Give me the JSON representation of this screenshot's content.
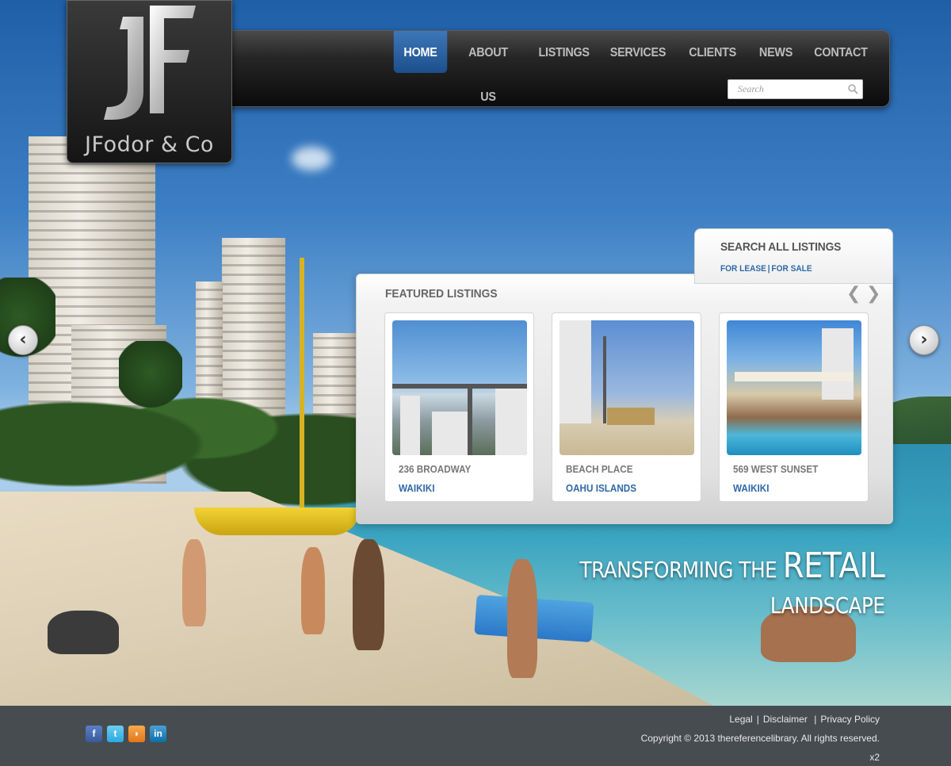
{
  "brand": {
    "name": "JFodor & Co",
    "logo_mark": "JF"
  },
  "nav": {
    "items": [
      {
        "label": "HOME",
        "active": true
      },
      {
        "label": "ABOUT US",
        "active": false
      },
      {
        "label": "LISTINGS",
        "active": false
      },
      {
        "label": "SERVICES",
        "active": false
      },
      {
        "label": "CLIENTS",
        "active": false
      },
      {
        "label": "NEWS",
        "active": false
      },
      {
        "label": "CONTACT",
        "active": false
      }
    ],
    "search_placeholder": "Search"
  },
  "search_all": {
    "title": "SEARCH ALL LISTINGS",
    "for_lease": "FOR LEASE",
    "separator": "|",
    "for_sale": "FOR SALE"
  },
  "featured": {
    "title": "FEATURED LISTINGS",
    "prev_icon": "❮",
    "next_icon": "❯",
    "listings": [
      {
        "address": "236 BROADWAY",
        "area": "WAIKIKI",
        "image": "city-view-from-balcony"
      },
      {
        "address": "BEACH PLACE",
        "area": "OAHU ISLANDS",
        "image": "beach-with-palms"
      },
      {
        "address": "569  WEST SUNSET",
        "area": "WAIKIKI",
        "image": "hotel-pool"
      }
    ]
  },
  "slider": {
    "prev_icon": "‹",
    "next_icon": "›"
  },
  "tagline": {
    "line1_small": "TRANSFORMING THE",
    "line1_big": "RETAIL",
    "line2": "LANDSCAPE"
  },
  "footer": {
    "social": [
      {
        "name": "facebook-icon",
        "glyph": "f"
      },
      {
        "name": "twitter-icon",
        "glyph": "t"
      },
      {
        "name": "rss-icon",
        "glyph": "◗"
      },
      {
        "name": "linkedin-icon",
        "glyph": "in"
      }
    ],
    "links": [
      "Legal",
      "Disclaimer",
      "Privacy Policy"
    ],
    "copyright": "Copyright ©  2013  thereferencelibrary. All rights reserved.",
    "x2": "x2"
  },
  "colors": {
    "accent": "#2f69a8",
    "nav_active": "#1c4f8c",
    "footer_bg": "#464646"
  }
}
